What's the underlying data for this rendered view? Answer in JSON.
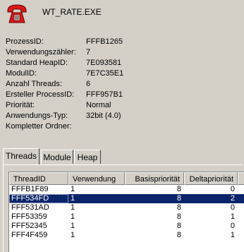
{
  "window": {
    "title": "WT_RATE.EXE",
    "icon": "red-telephone-icon"
  },
  "properties": [
    {
      "label": "ProzessID:",
      "value": "FFFB1265"
    },
    {
      "label": "Verwendungszähler:",
      "value": "7"
    },
    {
      "label": "Standard HeapID:",
      "value": "7E093581"
    },
    {
      "label": "ModulID:",
      "value": "7E7C35E1"
    },
    {
      "label": "Anzahl Threads:",
      "value": "6"
    },
    {
      "label": "Ersteller ProcessID:",
      "value": "FFF957B1"
    },
    {
      "label": "Priorität:",
      "value": "Normal"
    },
    {
      "label": "Anwendungs-Typ:",
      "value": "32bit (4.0)"
    },
    {
      "label": "Kompletter Ordner:",
      "value": ""
    }
  ],
  "tabs": [
    {
      "label": "Threads",
      "active": true
    },
    {
      "label": "Module",
      "active": false
    },
    {
      "label": "Heap",
      "active": false
    }
  ],
  "threads": {
    "columns": [
      "ThreadID",
      "Verwendung",
      "Basispriorität",
      "Deltapriorität",
      ""
    ],
    "rows": [
      {
        "thread_id": "FFFB1F89",
        "usage": "1",
        "base_priority": "8",
        "delta_priority": "0",
        "selected": false
      },
      {
        "thread_id": "FFF534FD",
        "usage": "1",
        "base_priority": "8",
        "delta_priority": "2",
        "selected": true
      },
      {
        "thread_id": "FFF531AD",
        "usage": "1",
        "base_priority": "8",
        "delta_priority": "0",
        "selected": false
      },
      {
        "thread_id": "FFF53359",
        "usage": "1",
        "base_priority": "8",
        "delta_priority": "1",
        "selected": false
      },
      {
        "thread_id": "FFF52345",
        "usage": "1",
        "base_priority": "8",
        "delta_priority": "0",
        "selected": false
      },
      {
        "thread_id": "FFF4F459",
        "usage": "1",
        "base_priority": "8",
        "delta_priority": "1",
        "selected": false
      }
    ]
  },
  "colors": {
    "selection": "#0a246a",
    "face": "#d4d0c8",
    "icon_red": "#d81818"
  }
}
